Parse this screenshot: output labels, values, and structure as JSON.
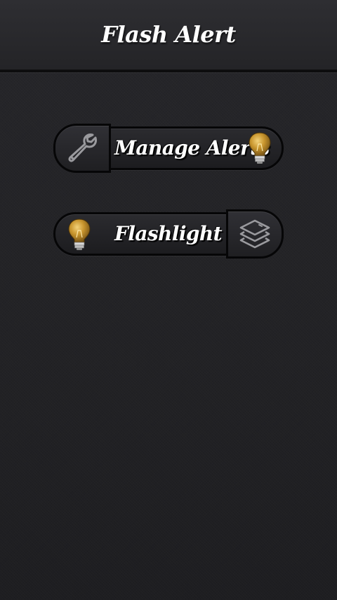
{
  "header": {
    "title": "Flash Alert"
  },
  "buttons": {
    "manage_alerts": {
      "label": "Manage Alerts",
      "left_icon": "wrench-icon",
      "right_icon": "lightbulb-icon"
    },
    "flashlight": {
      "label": "Flashlight",
      "left_icon": "lightbulb-icon",
      "right_icon": "layers-icon"
    }
  },
  "colors": {
    "background": "#222225",
    "header": "#2a2a2e",
    "text": "#ffffff",
    "bulb_gold": "#c9962e",
    "icon_gray": "#9a9a9e"
  }
}
